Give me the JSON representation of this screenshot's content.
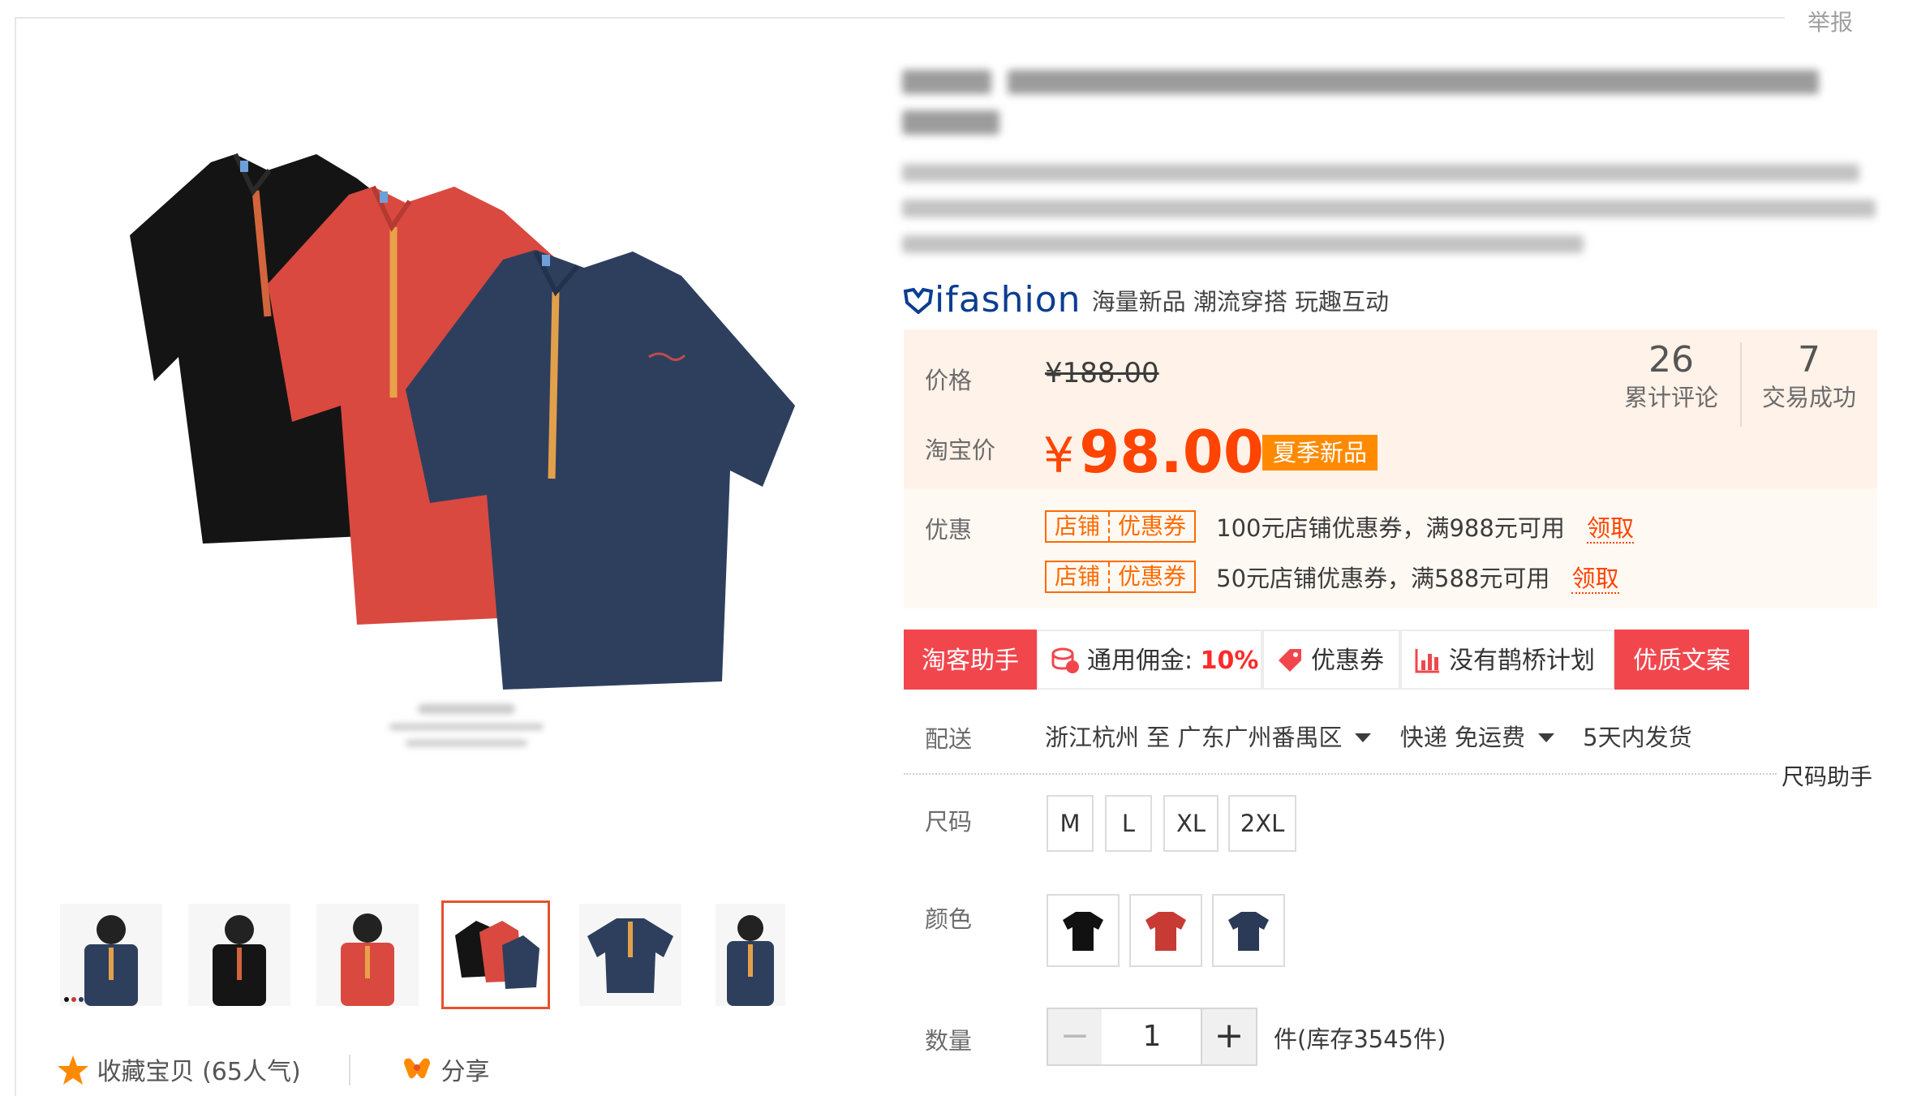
{
  "header": {
    "report": "举报"
  },
  "gallery": {
    "thumbnail_count": 6,
    "active_thumbnail": 4
  },
  "actions": {
    "favorite": "收藏宝贝",
    "favorite_count": "(65人气)",
    "share": "分享"
  },
  "brand": {
    "logo": "ifashion",
    "tagline": "海量新品 潮流穿搭 玩趣互动"
  },
  "price": {
    "label": "价格",
    "original": "¥188.00",
    "taobao_label": "淘宝价",
    "currency": "¥",
    "current": "98.00",
    "tag": "夏季新品"
  },
  "stats": [
    {
      "value": "26",
      "label": "累计评论"
    },
    {
      "value": "7",
      "label": "交易成功"
    }
  ],
  "promotions": {
    "label": "优惠",
    "coupons": [
      {
        "tag_left": "店铺",
        "tag_right": "优惠券",
        "text": "100元店铺优惠券，满988元可用",
        "action": "领取"
      },
      {
        "tag_left": "店铺",
        "tag_right": "优惠券",
        "text": "50元店铺优惠券，满588元可用",
        "action": "领取"
      }
    ]
  },
  "toolbar": {
    "assistant": "淘客助手",
    "commission_label": "通用佣金:",
    "commission_value": "10%",
    "coupon": "优惠券",
    "bridge": "没有鹊桥计划",
    "copywriting": "优质文案"
  },
  "shipping": {
    "label": "配送",
    "origin": "浙江杭州",
    "to": "至",
    "destination": "广东广州番禺区",
    "method": "快递",
    "fee": "免运费",
    "dispatch": "5天内发货"
  },
  "size_helper": "尺码助手",
  "sizes": {
    "label": "尺码",
    "options": [
      "M",
      "L",
      "XL",
      "2XL"
    ]
  },
  "colors": {
    "label": "颜色",
    "swatches": [
      "#111111",
      "#c83a34",
      "#2b3a56"
    ]
  },
  "quantity": {
    "label": "数量",
    "minus": "−",
    "value": "1",
    "plus": "+",
    "stock": "件(库存3545件)"
  },
  "colors_palette": {
    "accent": "#ff4400",
    "price_bg": "#fff2e8",
    "toolbar_red": "#f2464d",
    "tag_orange": "#ff8a00",
    "active_border": "#e4522e"
  }
}
